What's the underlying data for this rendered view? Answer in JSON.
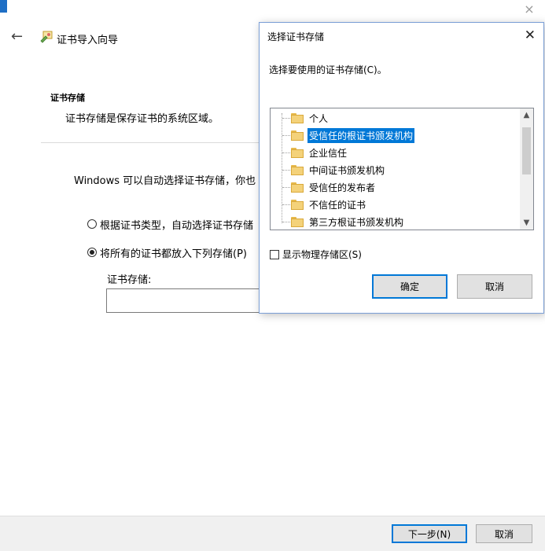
{
  "wizard": {
    "title": "证书导入向导",
    "section_title": "证书存储",
    "section_desc": "证书存储是保存证书的系统区域。",
    "body_text": "Windows 可以自动选择证书存储，你也",
    "option_auto": "根据证书类型，自动选择证书存储",
    "option_manual": "将所有的证书都放入下列存储(P)",
    "store_label": "证书存储:",
    "store_value": "",
    "next_button": "下一步(N)",
    "cancel_button": "取消",
    "close_glyph": "×",
    "back_glyph": "←"
  },
  "dialog": {
    "title": "选择证书存储",
    "close_glyph": "✕",
    "prompt": "选择要使用的证书存储(C)。",
    "stores": [
      "个人",
      "受信任的根证书颁发机构",
      "企业信任",
      "中间证书颁发机构",
      "受信任的发布者",
      "不信任的证书",
      "第三方根证书颁发机构"
    ],
    "selected_store": "受信任的根证书颁发机构",
    "show_physical_label": "显示物理存储区(S)",
    "ok_button": "确定",
    "cancel_button": "取消"
  },
  "colors": {
    "accent": "#0078d7",
    "title_bar_edge": "#1f6fc5",
    "folder": "#f4d27a"
  }
}
